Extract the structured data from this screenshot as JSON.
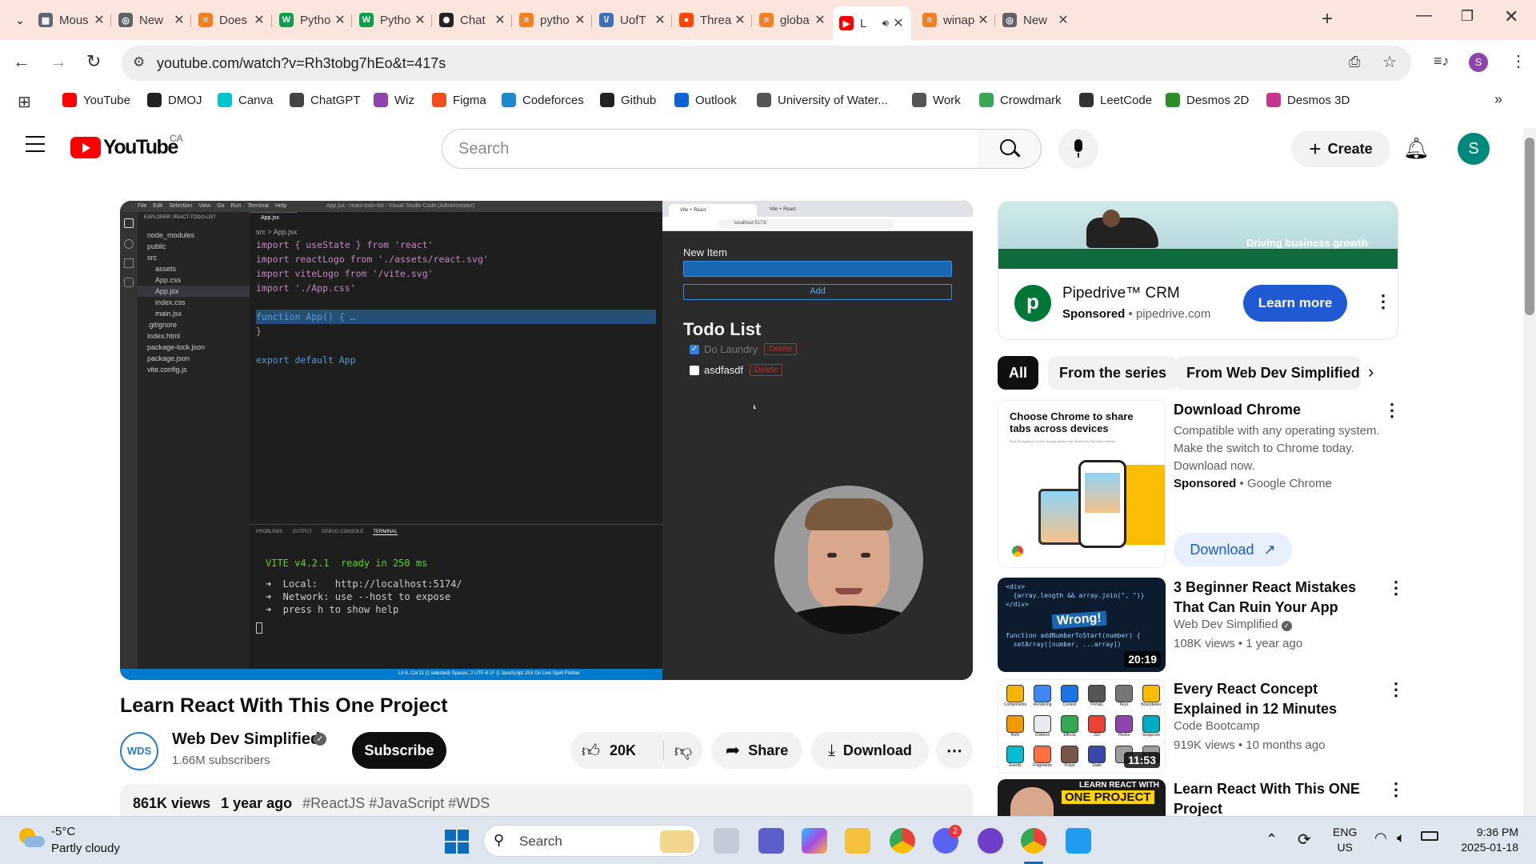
{
  "tabs": [
    {
      "title": "Mous",
      "color": "#5b6573",
      "glyph": "▦"
    },
    {
      "title": "New",
      "color": "#5f6368",
      "glyph": "◎"
    },
    {
      "title": "Does",
      "color": "#f48024",
      "glyph": "≡"
    },
    {
      "title": "Pytho",
      "color": "#07a14e",
      "glyph": "W"
    },
    {
      "title": "Pytho",
      "color": "#07a14e",
      "glyph": "W"
    },
    {
      "title": "Chat",
      "color": "#222222",
      "glyph": "✺"
    },
    {
      "title": "pytho",
      "color": "#f48024",
      "glyph": "≡"
    },
    {
      "title": "UofT",
      "color": "#3f6fb5",
      "glyph": "\\/"
    },
    {
      "title": "Threa",
      "color": "#ff4500",
      "glyph": "●"
    },
    {
      "title": "globa",
      "color": "#f48024",
      "glyph": "≡"
    },
    {
      "title": "L",
      "color": "#ff0000",
      "glyph": "▶",
      "active": true
    },
    {
      "title": "winap",
      "color": "#f48024",
      "glyph": "≡"
    },
    {
      "title": "New",
      "color": "#5f6368",
      "glyph": "◎"
    }
  ],
  "address": {
    "url": "youtube.com/watch?v=Rh3tobg7hEo&t=417s"
  },
  "profile_initial": "S",
  "bookmarks": [
    {
      "label": "YouTube",
      "color": "#ff0000"
    },
    {
      "label": "DMOJ",
      "color": "#222222"
    },
    {
      "label": "Canva",
      "color": "#00c4cc"
    },
    {
      "label": "ChatGPT",
      "color": "#444444"
    },
    {
      "label": "Wiz",
      "color": "#8e44ad"
    },
    {
      "label": "Figma",
      "color": "#f24e1e"
    },
    {
      "label": "Codeforces",
      "color": "#1f8acb"
    },
    {
      "label": "Github",
      "color": "#222222"
    },
    {
      "label": "Outlook",
      "color": "#0a64d6"
    },
    {
      "label": "University of Water...",
      "color": "#555555"
    },
    {
      "label": "Work",
      "color": "#555555"
    },
    {
      "label": "Crowdmark",
      "color": "#3aa657"
    },
    {
      "label": "LeetCode",
      "color": "#333333"
    },
    {
      "label": "Desmos 2D",
      "color": "#2a8c2a"
    },
    {
      "label": "Desmos 3D",
      "color": "#c8338d"
    }
  ],
  "youtube": {
    "logo_text": "YouTube",
    "region": "CA",
    "search_placeholder": "Search",
    "create_label": "Create",
    "avatar_initial": "S"
  },
  "video": {
    "vscode": {
      "title": "App.jsx - react-todo-list - Visual Studio Code (Administrator)",
      "menu": [
        "File",
        "Edit",
        "Selection",
        "View",
        "Go",
        "Run",
        "Terminal",
        "Help"
      ],
      "explorer_header": "EXPLORER: REACT-TODO-LIST",
      "files": [
        "node_modules",
        "public",
        "src",
        "assets",
        "App.css",
        "App.jsx",
        "index.css",
        "main.jsx",
        ".gitignore",
        "index.html",
        "package-lock.json",
        "package.json",
        "vite.config.js"
      ],
      "tab": "App.jsx",
      "breadcrumb": "src > App.jsx",
      "code": [
        "import { useState } from 'react'",
        "import reactLogo from './assets/react.svg'",
        "import viteLogo from '/vite.svg'",
        "import './App.css'",
        "",
        "function App() { …",
        "}",
        "",
        "export default App"
      ],
      "panel_tabs": [
        "PROBLEMS",
        "OUTPUT",
        "DEBUG CONSOLE",
        "TERMINAL"
      ],
      "terminal": [
        "VITE v4.2.1  ready in 250 ms",
        "➜  Local:   http://localhost:5174/",
        "➜  Network: use --host to expose",
        "➜  press h to show help"
      ],
      "status": "Ln 6, Col 11 (1 selected)   Spaces: 2   UTF-8   LF   {} JavaScript JSX   Go Live   Spell   Prettier"
    },
    "browser": {
      "tabs": [
        "Vite + React",
        "Vite + React"
      ],
      "url": "localhost:5173/",
      "new_item_label": "New Item",
      "add_label": "Add",
      "heading": "Todo List",
      "items": [
        {
          "text": "Do Laundry",
          "checked": true,
          "delete": "Delete"
        },
        {
          "text": "asdfasdf",
          "checked": false,
          "delete": "Delete"
        }
      ]
    }
  },
  "meta": {
    "title": "Learn React With This One Project",
    "channel": "Web Dev Simplified",
    "channel_badge": "WDS",
    "subscribers": "1.66M subscribers",
    "subscribe_label": "Subscribe",
    "likes": "20K",
    "share_label": "Share",
    "download_label": "Download",
    "views": "861K views",
    "age": "1 year ago",
    "tags": "#ReactJS #JavaScript #WDS"
  },
  "ad": {
    "banner_text": "Driving business growth",
    "name": "Pipedrive™ CRM",
    "sponsored": "Sponsored",
    "domain": "pipedrive.com",
    "cta": "Learn more",
    "logo": "p"
  },
  "chips": [
    "All",
    "From the series",
    "From Web Dev Simplified"
  ],
  "recs": [
    {
      "title": "Download Chrome",
      "lines": [
        "Compatible with any operating system. Make the switch to Chrome today. Download now."
      ],
      "sponsored": "Sponsored",
      "advertiser": "Google Chrome",
      "cta": "Download",
      "thumb_text": "Choose Chrome to share tabs across devices",
      "thumb_sub": "Must be signed in to your Google account on all devices. Requires internet."
    },
    {
      "title": "3 Beginner React Mistakes That Can Ruin Your App",
      "channel": "Web Dev Simplified",
      "stats": "108K views • 1 year ago",
      "duration": "20:19",
      "thumb_code": [
        "<div>",
        "  {array.length && array.join(\", \")}",
        "</div>",
        "function addNumberToStart(number) {",
        "  setArray([number, ...array])"
      ],
      "thumb_label": "Wrong!"
    },
    {
      "title": "Every React Concept Explained in 12 Minutes",
      "channel": "Code Bootcamp",
      "stats": "919K views • 10 months ago",
      "duration": "11:53",
      "concepts": [
        "Components",
        "Rendering",
        "Context",
        "Portals",
        "Keys",
        "Boundaries",
        "Refs",
        "Children",
        "Effects",
        "JSX",
        "Hooks",
        "Suspense",
        "Events",
        "Fragments",
        "Props",
        "State",
        "",
        ""
      ]
    },
    {
      "title": "Learn React With This ONE Project",
      "thumb_banner_1": "LEARN REACT WITH",
      "thumb_banner_2": "ONE PROJECT"
    }
  ],
  "taskbar": {
    "temp": "-5°C",
    "weather": "Partly cloudy",
    "search_label": "Search",
    "discord_badge": "2",
    "lang_1": "ENG",
    "lang_2": "US",
    "time": "9:36 PM",
    "date": "2025-01-18"
  },
  "colors": {
    "yt_red": "#ff0000",
    "vscode_blue": "#007acc",
    "pipedrive_green": "#017737",
    "learn_more_blue": "#1f5ad4",
    "tab_strip": "#fbe5dd"
  }
}
